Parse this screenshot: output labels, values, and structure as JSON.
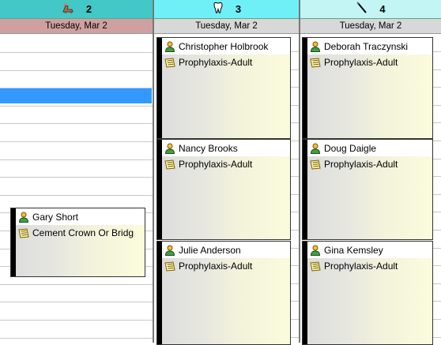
{
  "columns": [
    {
      "number": "2",
      "icon": "chair-icon",
      "date": "Tuesday, Mar 2",
      "header_color": "#43c7c7",
      "date_color": "#d0a0a0"
    },
    {
      "number": "3",
      "icon": "tooth-icon",
      "date": "Tuesday, Mar 2",
      "header_color": "#6ff0f7",
      "date_color": "#d8d8d8"
    },
    {
      "number": "4",
      "icon": "probe-icon",
      "date": "Tuesday, Mar 2",
      "header_color": "#c3f5f5",
      "date_color": "#d8d8d8"
    }
  ],
  "appointments": [
    {
      "patient": "Gary Short",
      "procedure": "Cement Crown Or Bridg"
    },
    {
      "patient": "Christopher Holbrook",
      "procedure": "Prophylaxis-Adult"
    },
    {
      "patient": "Nancy Brooks",
      "procedure": "Prophylaxis-Adult"
    },
    {
      "patient": "Julie Anderson",
      "procedure": "Prophylaxis-Adult"
    },
    {
      "patient": "Deborah Traczynski",
      "procedure": "Prophylaxis-Adult"
    },
    {
      "patient": "Doug Daigle",
      "procedure": "Prophylaxis-Adult"
    },
    {
      "patient": "Gina Kemsley",
      "procedure": "Prophylaxis-Adult"
    }
  ],
  "colors": {
    "selected_slot": "#3399ff",
    "appointment_bg": "#fbfbdc",
    "grid_line": "#c8c8c8"
  }
}
